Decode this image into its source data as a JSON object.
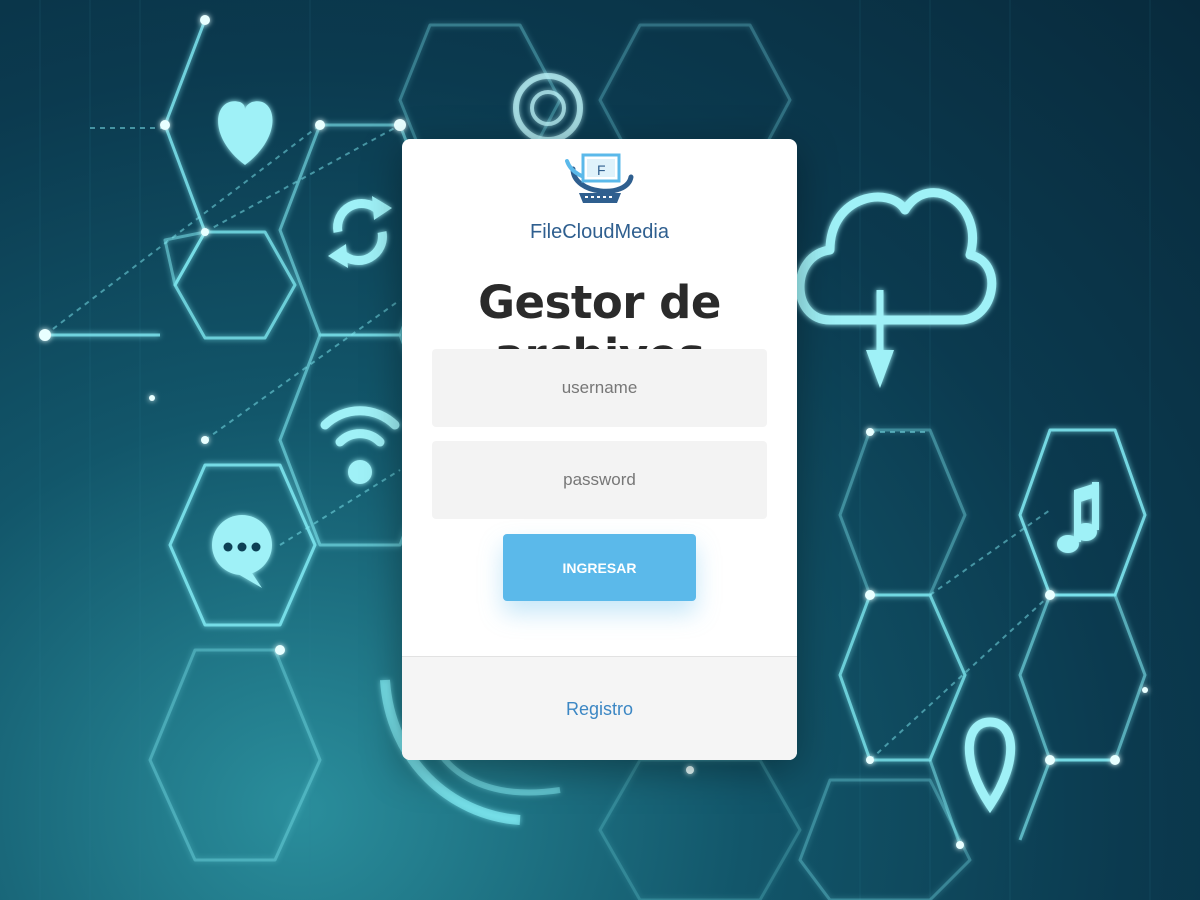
{
  "brand": {
    "name": "FileCloudMedia",
    "logo_icon": "monitor-f-logo-icon",
    "color": "#2f5f8f"
  },
  "login": {
    "title": "Gestor de archivos",
    "username_placeholder": "username",
    "password_placeholder": "password",
    "submit_label": "INGRESAR",
    "register_link": "Registro"
  },
  "colors": {
    "accent": "#5bb9ea",
    "link": "#3c87c4",
    "background": "#0b3a4f"
  },
  "background_icons": [
    "heart-icon",
    "refresh-icon",
    "wifi-icon",
    "chat-icon",
    "cloud-download-icon",
    "music-note-icon",
    "location-pin-icon"
  ]
}
